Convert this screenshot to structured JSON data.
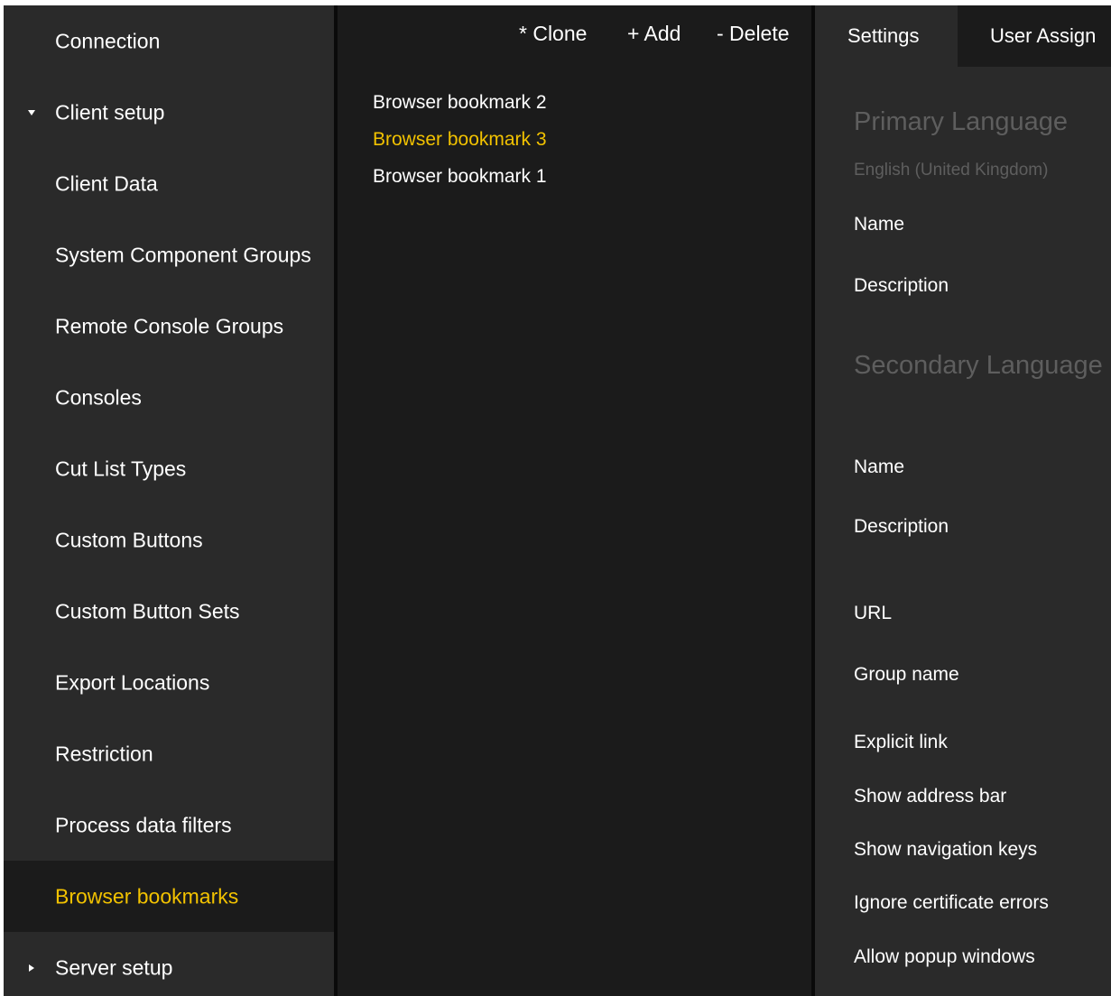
{
  "sidebar": {
    "items": [
      {
        "label": "Connection"
      },
      {
        "label": "Client setup",
        "expanded": true
      },
      {
        "label": "Client Data"
      },
      {
        "label": "System Component Groups"
      },
      {
        "label": "Remote Console Groups"
      },
      {
        "label": "Consoles"
      },
      {
        "label": "Cut List Types"
      },
      {
        "label": "Custom Buttons"
      },
      {
        "label": "Custom Button Sets"
      },
      {
        "label": "Export Locations"
      },
      {
        "label": "Restriction"
      },
      {
        "label": "Process data filters"
      },
      {
        "label": "Browser bookmarks",
        "active": true
      },
      {
        "label": "Server setup",
        "expanded": false
      }
    ]
  },
  "toolbar": {
    "clone_label": "* Clone",
    "add_label": "+ Add",
    "delete_label": "- Delete"
  },
  "bookmarks": {
    "items": [
      {
        "label": "Browser bookmark 2"
      },
      {
        "label": "Browser bookmark 3",
        "selected": true
      },
      {
        "label": "Browser bookmark 1"
      }
    ]
  },
  "tabs": {
    "settings": "Settings",
    "user_assign": "User Assign"
  },
  "details": {
    "primary_language_title": "Primary Language",
    "primary_language_value": "English (United Kingdom)",
    "primary_name_label": "Name",
    "primary_description_label": "Description",
    "secondary_language_title": "Secondary Language",
    "secondary_name_label": "Name",
    "secondary_description_label": "Description",
    "url_label": "URL",
    "group_name_label": "Group name",
    "explicit_link_label": "Explicit link",
    "show_address_bar_label": "Show address bar",
    "show_navigation_keys_label": "Show navigation keys",
    "ignore_certificate_errors_label": "Ignore certificate errors",
    "allow_popup_windows_label": "Allow popup windows"
  },
  "colors": {
    "accent": "#f2c200",
    "sidebar_bg": "#2a2a2a",
    "pane_bg": "#1b1b1b",
    "muted_text": "#5e5e5e"
  }
}
